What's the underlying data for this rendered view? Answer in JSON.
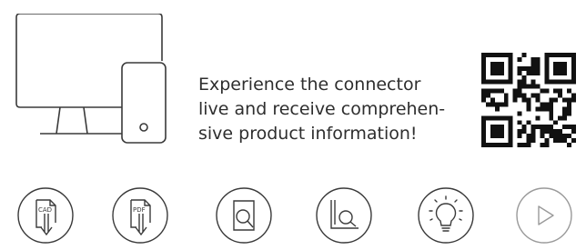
{
  "promo": {
    "line1": "Experience the connector",
    "line2": "live and receive comprehen-",
    "line3": "sive product information!"
  },
  "illustration": {
    "icon": "desktop-and-phone-icon"
  },
  "qr": {
    "icon": "qr-code-icon"
  },
  "actions": [
    {
      "name": "cad-download",
      "badge": "CAD",
      "icon": "cad-download-icon"
    },
    {
      "name": "pdf-download",
      "badge": "PDF",
      "icon": "pdf-download-icon"
    },
    {
      "name": "product-search",
      "icon": "document-search-icon"
    },
    {
      "name": "chart-analysis",
      "icon": "chart-search-icon"
    },
    {
      "name": "idea",
      "icon": "lightbulb-icon"
    },
    {
      "name": "play-video",
      "icon": "play-icon"
    }
  ],
  "colors": {
    "stroke": "#3a3a3a",
    "qr": "#111111",
    "play_stroke": "#9a9a9a"
  }
}
